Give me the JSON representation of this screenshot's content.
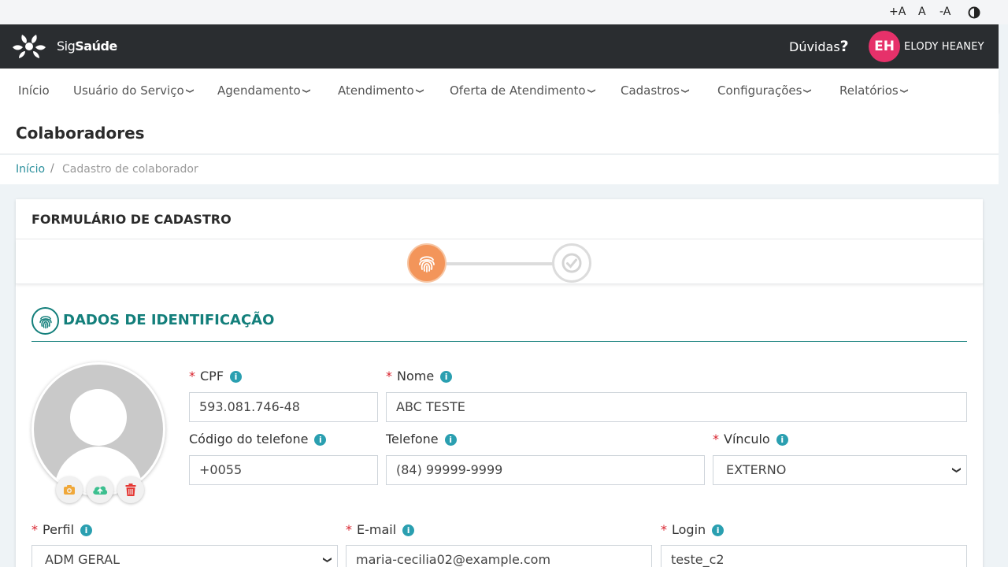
{
  "accessibility": {
    "increase_font": "+A",
    "reset_font": "A",
    "decrease_font": "-A"
  },
  "header": {
    "brand_prefix": "Sig",
    "brand_suffix": "Saúde",
    "help_label": "Dúvidas",
    "help_mark": "?",
    "user_initials": "EH",
    "user_name": "ELODY HEANEY"
  },
  "nav": {
    "items": [
      {
        "label": "Início"
      },
      {
        "label": "Usuário do Serviço"
      },
      {
        "label": "Agendamento"
      },
      {
        "label": "Atendimento"
      },
      {
        "label": "Oferta de Atendimento"
      },
      {
        "label": "Cadastros"
      },
      {
        "label": "Configurações"
      },
      {
        "label": "Relatórios"
      }
    ]
  },
  "page": {
    "title": "Colaboradores"
  },
  "breadcrumb": {
    "home": "Início",
    "separator": "/",
    "current": "Cadastro de colaborador"
  },
  "form": {
    "title": "FORMULÁRIO DE CADASTRO",
    "section_title": "DADOS DE IDENTIFICAÇÃO",
    "required_mark": "*",
    "info_mark": "i",
    "fields": {
      "cpf": {
        "label": "CPF",
        "value": "593.081.746-48"
      },
      "nome": {
        "label": "Nome",
        "value": "ABC TESTE"
      },
      "codigo_telefone": {
        "label": "Código do telefone",
        "value": "+0055"
      },
      "telefone": {
        "label": "Telefone",
        "value": "(84) 99999-9999"
      },
      "vinculo": {
        "label": "Vínculo",
        "value": "EXTERNO"
      },
      "perfil": {
        "label": "Perfil",
        "value": "ADM GERAL"
      },
      "email": {
        "label": "E-mail",
        "value": "maria-cecilia02@example.com"
      },
      "login": {
        "label": "Login",
        "value": "teste_c2"
      }
    }
  },
  "colors": {
    "topbar": "#2a2d30",
    "accent_teal": "#137f7b",
    "step_active": "#f3955a",
    "avatar": "#e6316a",
    "required": "#d9232e",
    "info": "#2a9fb0"
  },
  "icons": [
    "contrast-icon",
    "logo-icon",
    "fingerprint-icon",
    "check-circle-icon",
    "camera-icon",
    "cloud-upload-icon",
    "trash-icon",
    "chevron-down-icon",
    "info-icon"
  ]
}
